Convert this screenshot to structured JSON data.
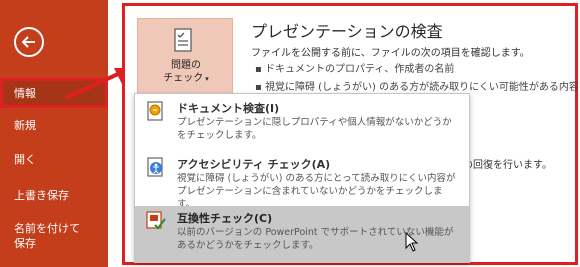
{
  "sidebar": {
    "items": [
      {
        "label": "情報"
      },
      {
        "label": "新規"
      },
      {
        "label": "開く"
      },
      {
        "label": "上書き保存"
      },
      {
        "label": "名前を付けて\n保存"
      }
    ]
  },
  "tile": {
    "label_line1": "問題の",
    "label_line2": "チェック",
    "caret": "▾"
  },
  "section": {
    "title": "プレゼンテーションの検査",
    "desc": "ファイルを公開する前に、ファイルの次の項目を確認します。",
    "bullets": [
      "ドキュメントのプロパティ、作成者の名前",
      "視覚に障碍 (しょうがい) のある方が読み取りにくい可能性がある内容"
    ],
    "partial_right": "の回復を行います。"
  },
  "menu": {
    "items": [
      {
        "title": "ドキュメント検査(I)",
        "desc": "プレゼンテーションに隠しプロパティや個人情報がないかどうかをチェックします。"
      },
      {
        "title": "アクセシビリティ チェック(A)",
        "desc": "視覚に障碍 (しょうがい) のある方にとって読み取りにくい内容がプレゼンテーションに含まれていないかどうかをチェックします。"
      },
      {
        "title": "互換性チェック(C)",
        "desc": "以前のバージョンの PowerPoint でサポートされていない機能があるかどうかをチェックします。"
      }
    ]
  },
  "colors": {
    "sidebar": "#c43e1c",
    "highlight": "#e02020",
    "tile": "#f0c8b8",
    "hover": "#c8c8c8"
  },
  "icons": [
    "back-arrow-icon",
    "check-issues-icon",
    "document-inspect-icon",
    "accessibility-icon",
    "compatibility-icon",
    "mouse-cursor-icon"
  ]
}
